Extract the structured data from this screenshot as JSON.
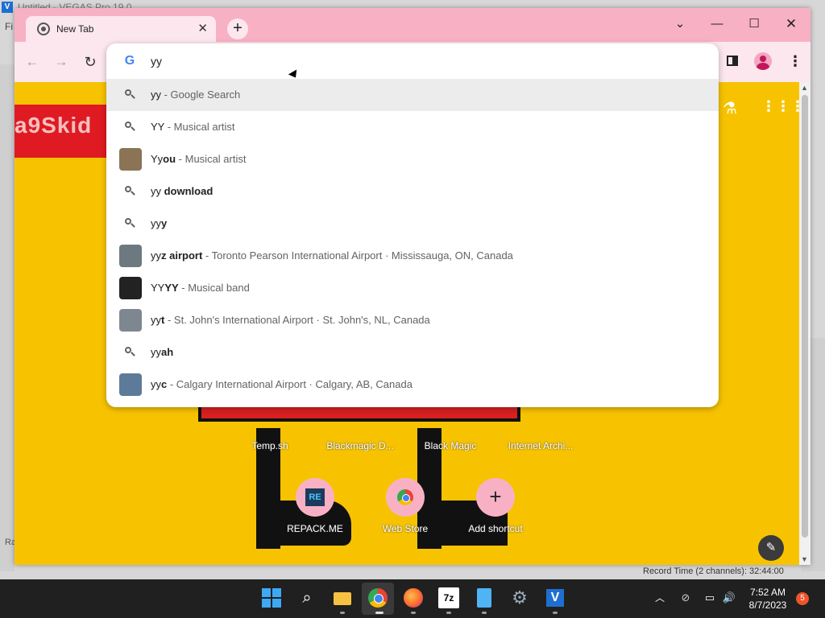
{
  "background_app": {
    "title": "Untitled - VEGAS Pro 19.0",
    "menu_partial": "Fi",
    "record_time": "Record Time (2 channels): 32:44:00",
    "side_label": "Ra"
  },
  "browser": {
    "tab": {
      "title": "New Tab",
      "close_glyph": "✕"
    },
    "new_tab_glyph": "+",
    "window_controls": {
      "tab_search": "⌄",
      "minimize": "—",
      "maximize": "☐",
      "close": "✕"
    },
    "nav": {
      "back": "←",
      "forward": "→",
      "reload": "↻"
    },
    "menu_glyph": "⋮",
    "omnibox": {
      "value": "yy",
      "suggestions": [
        {
          "kind": "search",
          "typed": "yy",
          "bold": "",
          "desc": " - Google Search",
          "selected": true
        },
        {
          "kind": "search",
          "typed": "YY",
          "bold": "",
          "desc": " - Musical artist"
        },
        {
          "kind": "image",
          "typed": "Yy",
          "bold": "ou",
          "desc": " - Musical artist",
          "thumb_color": "#8b7355"
        },
        {
          "kind": "search",
          "typed": "yy",
          "bold": " download",
          "desc": ""
        },
        {
          "kind": "search",
          "typed": "yy",
          "bold": "y",
          "desc": ""
        },
        {
          "kind": "image",
          "typed": "yy",
          "bold": "z airport",
          "desc": " - Toronto Pearson International Airport · Mississauga, ON, Canada",
          "thumb_color": "#6c7a80"
        },
        {
          "kind": "image",
          "typed": "YY",
          "bold": "YY",
          "desc": " - Musical band",
          "thumb_color": "#222222"
        },
        {
          "kind": "image",
          "typed": "yy",
          "bold": "t",
          "desc": " - St. John's International Airport · St. John's, NL, Canada",
          "thumb_color": "#7e8790"
        },
        {
          "kind": "search",
          "typed": "yy",
          "bold": "ah",
          "desc": ""
        },
        {
          "kind": "image",
          "typed": "yy",
          "bold": "c",
          "desc": " - Calgary International Airport · Calgary, AB, Canada",
          "thumb_color": "#5d7a99"
        }
      ]
    },
    "ntp": {
      "banner_text": "a9Skid",
      "labs_glyph": "⚗",
      "apps_glyph": "⋮⋮⋮",
      "shortcuts": [
        {
          "label": "Temp.sh"
        },
        {
          "label": "Blackmagic D..."
        },
        {
          "label": "Black Magic"
        },
        {
          "label": "Internet Archi..."
        },
        {
          "label": "REPACK.ME",
          "icon_text": "RE"
        },
        {
          "label": "Web Store"
        },
        {
          "label": "Add shortcut",
          "icon_text": "+"
        }
      ],
      "customize_glyph": "✎"
    }
  },
  "taskbar": {
    "clock_time": "7:52 AM",
    "clock_date": "8/7/2023",
    "notification_count": "5",
    "sevenzip_label": "7z",
    "tray": {
      "chevron": "︿",
      "network": "⊘",
      "display": "▭",
      "volume": "🔊"
    },
    "search_glyph": "⌕",
    "settings_glyph": "⚙",
    "vegas_glyph": "V"
  }
}
